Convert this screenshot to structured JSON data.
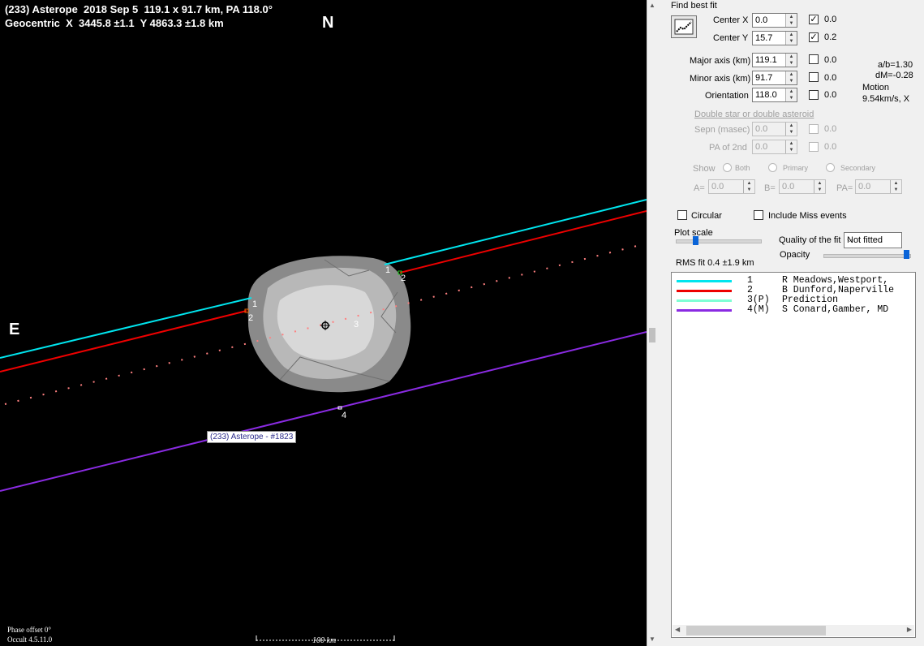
{
  "plot": {
    "title_line1": "(233) Asterope  2018 Sep 5  119.1 x 91.7 km, PA 118.0°",
    "title_line2": "Geocentric  X  3445.8 ±1.1  Y 4863.3 ±1.8 km",
    "north": "N",
    "east": "E",
    "phase_offset": "Phase offset 0°",
    "version": "Occult 4.5.11.0",
    "scale_label": "100 km",
    "asteroid_label": "(233) Asterope - #1823",
    "chord_labels": [
      "1",
      "2",
      "1",
      "2",
      "3",
      "4"
    ],
    "chord_colors": {
      "c1": "#00e5ee",
      "c2": "#ee0000",
      "c3": "#ff8080",
      "c4": "#8a2be2"
    }
  },
  "panel": {
    "find_best_fit": "Find best fit",
    "center_x": {
      "label": "Center X",
      "value": "0.0",
      "checked": true,
      "result": "0.0"
    },
    "center_y": {
      "label": "Center Y",
      "value": "15.7",
      "checked": true,
      "result": "0.2"
    },
    "major_axis": {
      "label": "Major axis (km)",
      "value": "119.1",
      "checked": false,
      "result": "0.0"
    },
    "minor_axis": {
      "label": "Minor axis (km)",
      "value": "91.7",
      "checked": false,
      "result": "0.0"
    },
    "orientation": {
      "label": "Orientation",
      "value": "118.0",
      "checked": false,
      "result": "0.0"
    },
    "ab_ratio": "a/b=1.30",
    "dm": "dM=-0.28",
    "motion_label": "Motion",
    "motion_value": "9.54km/s, X",
    "double_star_link": "Double star  or  double asteroid",
    "sepn": {
      "label": "Sepn (masec)",
      "value": "0.0",
      "result": "0.0"
    },
    "pa2nd": {
      "label": "PA of 2nd",
      "value": "0.0",
      "result": "0.0"
    },
    "show_label": "Show",
    "show_both": "Both",
    "show_primary": "Primary",
    "show_secondary": "Secondary",
    "a_label": "A=",
    "a_value": "0.0",
    "b_label": "B=",
    "b_value": "0.0",
    "pa_label": "PA=",
    "pa_value": "0.0",
    "circular": "Circular",
    "include_miss": "Include Miss events",
    "plot_scale": "Plot scale",
    "quality_label": "Quality of the fit",
    "quality_value": "Not fitted",
    "opacity": "Opacity",
    "rms_fit": "RMS fit  0.4 ±1.9 km"
  },
  "observers": [
    {
      "num": "1   ",
      "name": "R Meadows,Westport,",
      "color": "#00e5ee"
    },
    {
      "num": "2   ",
      "name": "B Dunford,Naperville",
      "color": "#ee0000"
    },
    {
      "num": "3(P)",
      "name": "Prediction",
      "color": "#7fffd4"
    },
    {
      "num": "4(M)",
      "name": "S Conard,Gamber, MD",
      "color": "#8a2be2"
    }
  ]
}
